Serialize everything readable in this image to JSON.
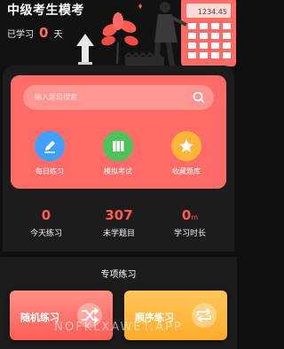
{
  "header": {
    "title": "中级考生模考",
    "studied_prefix": "已学习",
    "studied_days": "0",
    "studied_unit": "天",
    "calculator_display": "1234.45"
  },
  "search": {
    "placeholder": "输入题目搜索"
  },
  "features": [
    {
      "label": "每日练习",
      "icon": "pencil-icon",
      "color": "#3ea1ff"
    },
    {
      "label": "模拟考试",
      "icon": "books-icon",
      "color": "#4cc35a"
    },
    {
      "label": "收藏题库",
      "icon": "star-icon",
      "color": "#ffb536"
    }
  ],
  "stats": [
    {
      "value": "0",
      "unit": "",
      "label": "今天练习"
    },
    {
      "value": "307",
      "unit": "",
      "label": "未学题目"
    },
    {
      "value": "0",
      "unit": "m",
      "label": "学习时长"
    }
  ],
  "section": {
    "title": "专项练习",
    "random_label": "随机练习",
    "ordered_label": "顺序练习"
  },
  "watermark": "NOFKLXAWET.APP",
  "colors": {
    "accent": "#ff6c67",
    "stat": "#ff5a4e",
    "orange": "#ffab2c"
  }
}
